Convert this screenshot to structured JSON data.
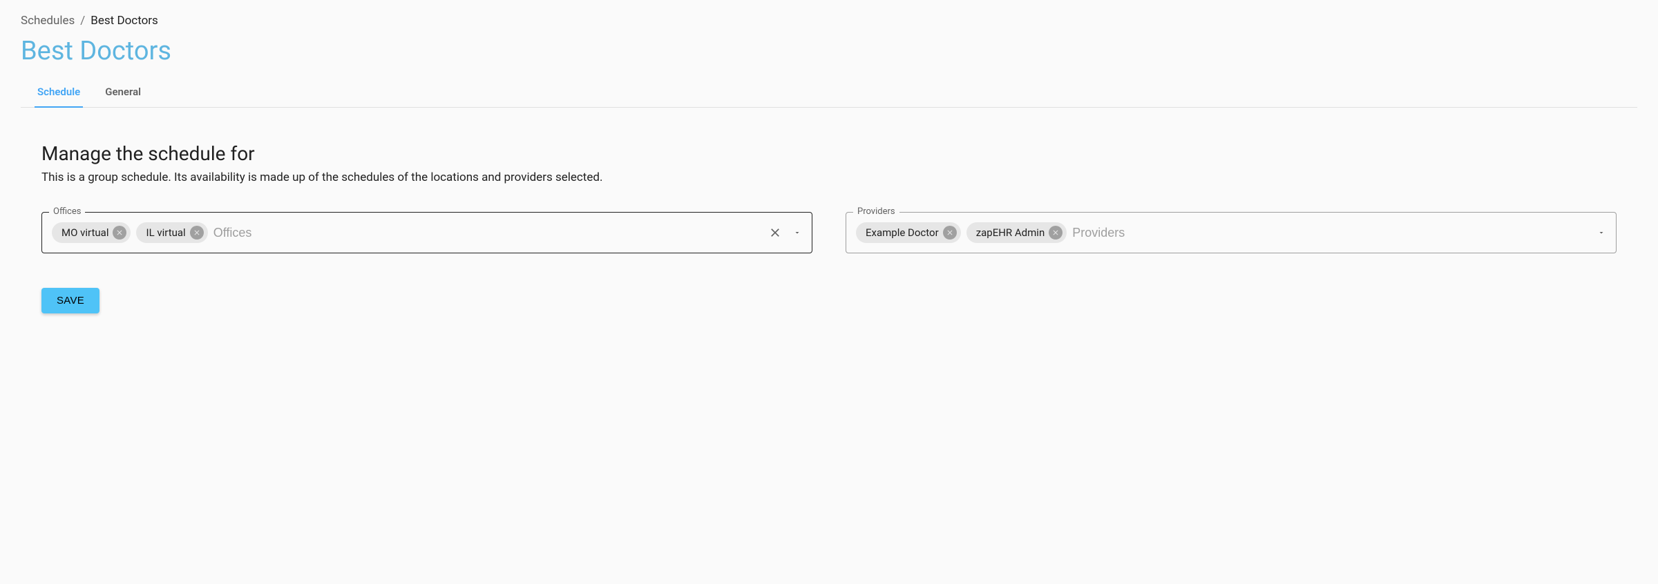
{
  "breadcrumb": {
    "parent": "Schedules",
    "separator": "/",
    "current": "Best Doctors"
  },
  "page_title": "Best Doctors",
  "tabs": [
    {
      "label": "Schedule",
      "active": true
    },
    {
      "label": "General",
      "active": false
    }
  ],
  "section": {
    "heading": "Manage the schedule for",
    "description": "This is a group schedule. Its availability is made up of the schedules of the locations and providers selected."
  },
  "offices": {
    "label": "Offices",
    "placeholder": "Offices",
    "chips": [
      "MO virtual",
      "IL virtual"
    ]
  },
  "providers": {
    "label": "Providers",
    "placeholder": "Providers",
    "chips": [
      "Example Doctor",
      "zapEHR Admin"
    ]
  },
  "save_label": "SAVE"
}
